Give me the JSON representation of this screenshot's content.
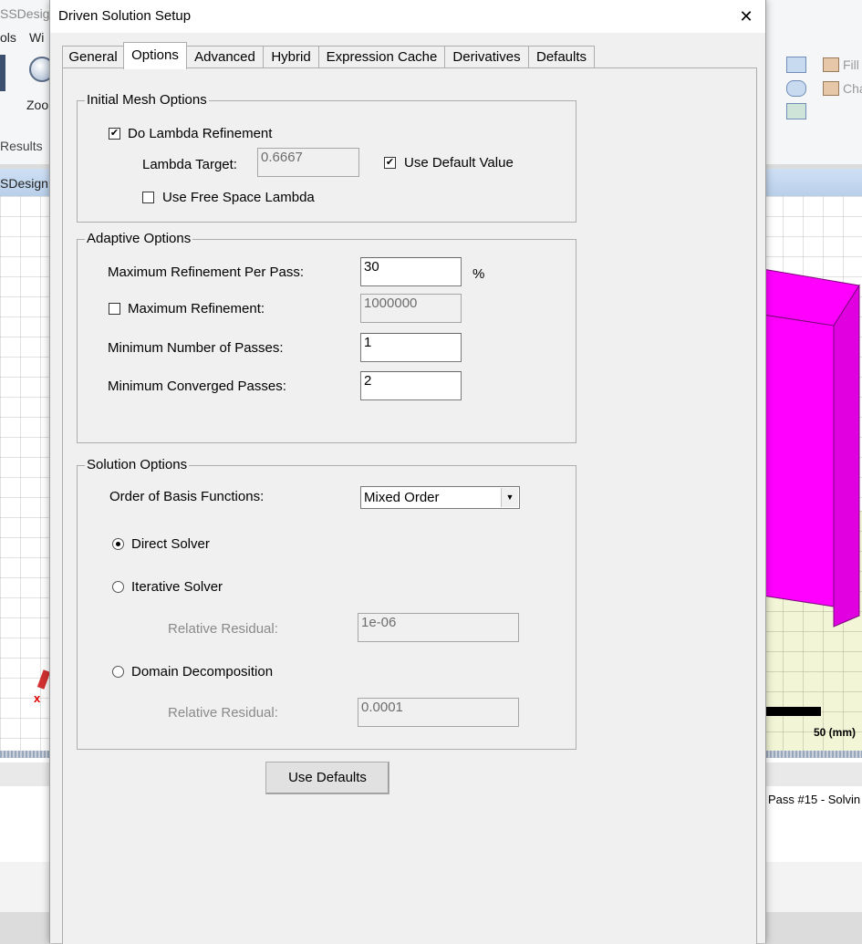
{
  "background_app": {
    "menu_left_1": "SSDesig",
    "menu_left_2": "ols",
    "menu_left_3": "Wi",
    "zoom_label": "Zoo",
    "results_label": "Results",
    "doc_tab": "SDesign",
    "fill_label": "Fill",
    "cha_label": "Cha",
    "scale_label": "50 (mm)",
    "status_text": "Pass #15 - Solvin",
    "axis_x": "x",
    "accent_magenta": "#ff00ff"
  },
  "dialog": {
    "title": "Driven Solution Setup",
    "close_glyph": "✕",
    "tabs": [
      {
        "label": "General"
      },
      {
        "label": "Options"
      },
      {
        "label": "Advanced"
      },
      {
        "label": "Hybrid"
      },
      {
        "label": "Expression Cache"
      },
      {
        "label": "Derivatives"
      },
      {
        "label": "Defaults"
      }
    ],
    "active_tab": "Options",
    "initial_mesh": {
      "legend": "Initial Mesh Options",
      "do_lambda_label": "Do Lambda Refinement",
      "do_lambda_checked": true,
      "lambda_target_label": "Lambda Target:",
      "lambda_target_value": "0.6667",
      "use_default_label": "Use Default Value",
      "use_default_checked": true,
      "free_space_label": "Use Free Space Lambda",
      "free_space_checked": false
    },
    "adaptive": {
      "legend": "Adaptive Options",
      "max_per_pass_label": "Maximum Refinement Per Pass:",
      "max_per_pass_value": "30",
      "percent_unit": "%",
      "max_refinement_label": "Maximum Refinement:",
      "max_refinement_checked": false,
      "max_refinement_value": "1000000",
      "min_passes_label": "Minimum Number of Passes:",
      "min_passes_value": "1",
      "min_converged_label": "Minimum Converged Passes:",
      "min_converged_value": "2"
    },
    "solution": {
      "legend": "Solution Options",
      "basis_label": "Order of Basis Functions:",
      "basis_value": "Mixed Order",
      "direct_label": "Direct Solver",
      "direct_selected": true,
      "iterative_label": "Iterative Solver",
      "iterative_residual_label": "Relative Residual:",
      "iterative_residual_value": "1e-06",
      "domain_label": "Domain Decomposition",
      "domain_residual_label": "Relative Residual:",
      "domain_residual_value": "0.0001"
    },
    "use_defaults_label": "Use Defaults"
  }
}
